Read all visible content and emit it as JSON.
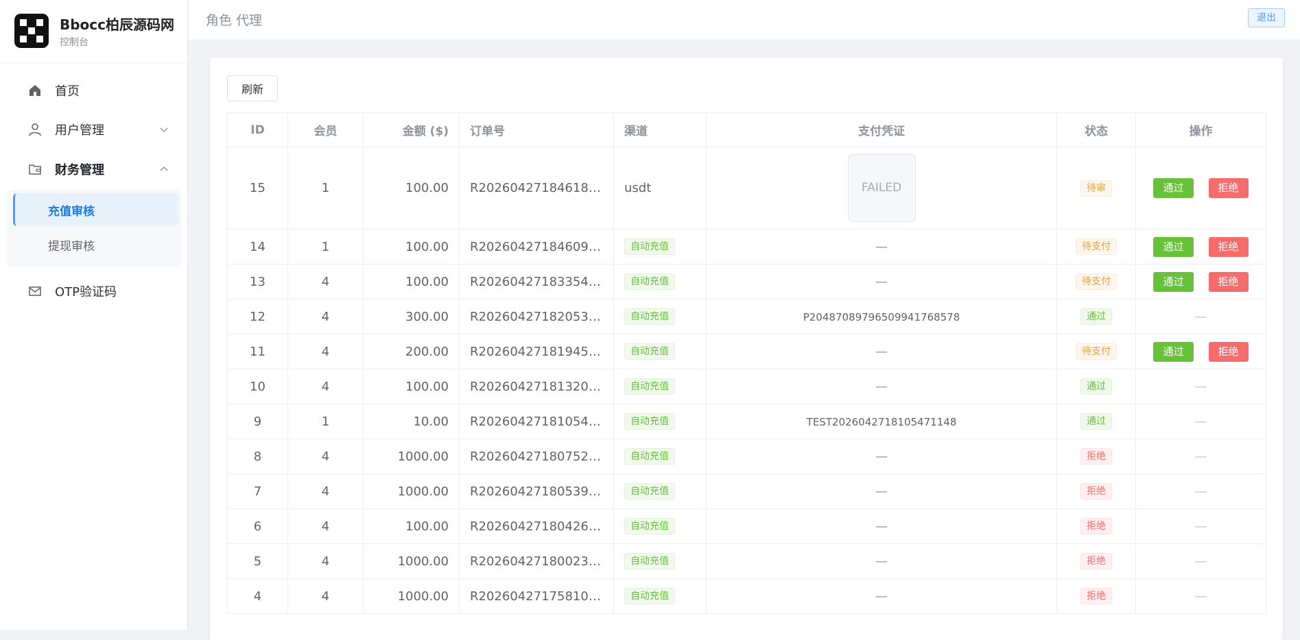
{
  "brand": {
    "name": "Bbocc柏辰源码网",
    "subtitle": "控制台"
  },
  "nav": {
    "home": "首页",
    "users": "用户管理",
    "finance": "财务管理",
    "recharge_review": "充值审核",
    "withdraw_review": "提现审核",
    "otp": "OTP验证码"
  },
  "header": {
    "breadcrumb": "角色 代理",
    "logout": "退出"
  },
  "toolbar": {
    "refresh": "刷新"
  },
  "table": {
    "columns": [
      "ID",
      "会员",
      "金额 ($)",
      "订单号",
      "渠道",
      "支付凭证",
      "状态",
      "操作"
    ],
    "approve_label": "通过",
    "reject_label": "拒绝",
    "rows": [
      {
        "id": "15",
        "member": "1",
        "amount": "100.00",
        "order": "R2026042718461876...",
        "channel": "usdt",
        "channel_tag": false,
        "voucher": "FAILED",
        "voucher_type": "image",
        "status": "待审",
        "status_color": "orange",
        "actions": true
      },
      {
        "id": "14",
        "member": "1",
        "amount": "100.00",
        "order": "R2026042718460924...",
        "channel": "自动充值",
        "channel_tag": true,
        "voucher": "—",
        "voucher_type": "dash",
        "status": "待支付",
        "status_color": "orange",
        "actions": true
      },
      {
        "id": "13",
        "member": "4",
        "amount": "100.00",
        "order": "R2026042718335495...",
        "channel": "自动充值",
        "channel_tag": true,
        "voucher": "—",
        "voucher_type": "dash",
        "status": "待支付",
        "status_color": "orange",
        "actions": true
      },
      {
        "id": "12",
        "member": "4",
        "amount": "300.00",
        "order": "R2026042718205317...",
        "channel": "自动充值",
        "channel_tag": true,
        "voucher": "P2048708979650994176857​8",
        "voucher_type": "text",
        "status": "通过",
        "status_color": "green",
        "actions": false
      },
      {
        "id": "11",
        "member": "4",
        "amount": "200.00",
        "order": "R2026042718194531...",
        "channel": "自动充值",
        "channel_tag": true,
        "voucher": "—",
        "voucher_type": "dash",
        "status": "待支付",
        "status_color": "orange",
        "actions": true
      },
      {
        "id": "10",
        "member": "4",
        "amount": "100.00",
        "order": "R2026042718132089...",
        "channel": "自动充值",
        "channel_tag": true,
        "voucher": "—",
        "voucher_type": "dash",
        "status": "通过",
        "status_color": "green",
        "actions": false
      },
      {
        "id": "9",
        "member": "1",
        "amount": "10.00",
        "order": "R2026042718105447...",
        "channel": "自动充值",
        "channel_tag": true,
        "voucher": "TEST2026042718105471148",
        "voucher_type": "text",
        "status": "通过",
        "status_color": "green",
        "actions": false
      },
      {
        "id": "8",
        "member": "4",
        "amount": "1000.00",
        "order": "R2026042718075227...",
        "channel": "自动充值",
        "channel_tag": true,
        "voucher": "—",
        "voucher_type": "dash",
        "status": "拒绝",
        "status_color": "red",
        "actions": false
      },
      {
        "id": "7",
        "member": "4",
        "amount": "1000.00",
        "order": "R2026042718053967...",
        "channel": "自动充值",
        "channel_tag": true,
        "voucher": "—",
        "voucher_type": "dash",
        "status": "拒绝",
        "status_color": "red",
        "actions": false
      },
      {
        "id": "6",
        "member": "4",
        "amount": "100.00",
        "order": "R2026042718042630...",
        "channel": "自动充值",
        "channel_tag": true,
        "voucher": "—",
        "voucher_type": "dash",
        "status": "拒绝",
        "status_color": "red",
        "actions": false
      },
      {
        "id": "5",
        "member": "4",
        "amount": "1000.00",
        "order": "R2026042718002359...",
        "channel": "自动充值",
        "channel_tag": true,
        "voucher": "—",
        "voucher_type": "dash",
        "status": "拒绝",
        "status_color": "red",
        "actions": false
      },
      {
        "id": "4",
        "member": "4",
        "amount": "1000.00",
        "order": "R2026042717581080...",
        "channel": "自动充值",
        "channel_tag": true,
        "voucher": "—",
        "voucher_type": "dash",
        "status": "拒绝",
        "status_color": "red",
        "actions": false
      }
    ],
    "empty_action": "—"
  },
  "colors": {
    "accent": "#409eff",
    "success": "#67c23a",
    "warning": "#e6a23c",
    "danger": "#f56c6c"
  }
}
